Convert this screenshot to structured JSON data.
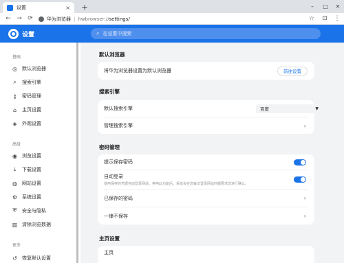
{
  "tab": {
    "title": "设置",
    "close": "×"
  },
  "window": {
    "new_tab": "+",
    "minimize": "–",
    "maximize": "□",
    "close": "✕"
  },
  "toolbar": {
    "back": "←",
    "forward": "→",
    "reload": "⟳",
    "url_app": "华为浏览器",
    "url_sep": "|",
    "url_host": "hwbrowser://",
    "url_path": "settings/",
    "star": "☆",
    "extensions": "⊡",
    "menu": "⋮"
  },
  "header": {
    "title": "设置",
    "search_placeholder": "在设置中搜索",
    "accent": "#1a73e8"
  },
  "sidebar": {
    "sections": [
      "基础",
      "高级",
      "更多"
    ],
    "items": [
      {
        "label": "默认浏览器",
        "icon": "browser-icon"
      },
      {
        "label": "搜索引擎",
        "icon": "search-icon"
      },
      {
        "label": "密码管理",
        "icon": "key-icon"
      },
      {
        "label": "主页设置",
        "icon": "home-icon"
      },
      {
        "label": "外观设置",
        "icon": "palette-icon"
      },
      {
        "label": "浏览设置",
        "icon": "eye-icon"
      },
      {
        "label": "下载设置",
        "icon": "download-icon"
      },
      {
        "label": "网站设置",
        "icon": "globe-icon"
      },
      {
        "label": "系统设置",
        "icon": "gear-icon"
      },
      {
        "label": "安全与隐私",
        "icon": "shield-icon"
      },
      {
        "label": "清除浏览数据",
        "icon": "trash-icon"
      },
      {
        "label": "恢复默认设置",
        "icon": "restore-icon"
      }
    ]
  },
  "main": {
    "default_browser": {
      "title": "默认浏览器",
      "row_label": "将华为浏览器设置为默认浏览器",
      "button": "前往设置"
    },
    "search_engine": {
      "title": "搜索引擎",
      "default_label": "默认搜索引擎",
      "selected": "百度",
      "manage_label": "管理搜索引擎"
    },
    "passwords": {
      "title": "密码管理",
      "offer_save": {
        "label": "提示保存密码",
        "enabled": true
      },
      "auto_login": {
        "label": "自动登录",
        "desc": "使用保存的凭据自动登录网站。停用此功能后，系统会在您每次登录网站时都要求您进行确认。",
        "enabled": true
      },
      "saved_label": "已保存的密码",
      "never_saved_label": "一律不保存"
    },
    "homepage": {
      "title": "主页设置",
      "first_row": "主页"
    }
  }
}
